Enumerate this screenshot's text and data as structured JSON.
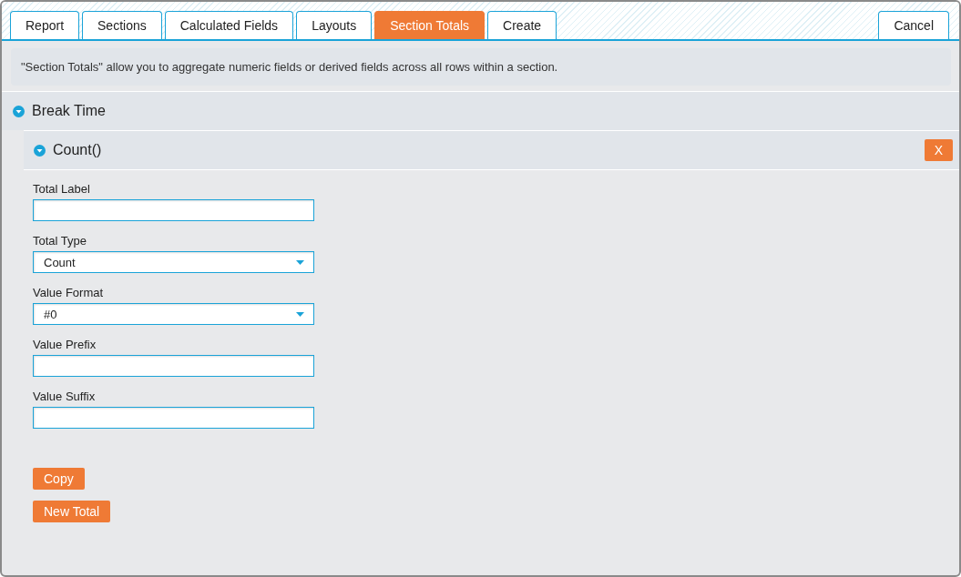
{
  "tabs": [
    {
      "label": "Report",
      "selected": false
    },
    {
      "label": "Sections",
      "selected": false
    },
    {
      "label": "Calculated Fields",
      "selected": false
    },
    {
      "label": "Layouts",
      "selected": false
    },
    {
      "label": "Section Totals",
      "selected": true
    },
    {
      "label": "Create",
      "selected": false
    }
  ],
  "cancel_button": "Cancel",
  "info": "\"Section Totals\" allow you to aggregate numeric fields or derived fields across all rows within a section.",
  "section": {
    "title": "Break Time",
    "expanded": true,
    "total": {
      "title": "Count()",
      "expanded": true,
      "remove_button": "X",
      "fields": [
        {
          "label": "Total Label",
          "kind": "text"
        },
        {
          "label": "Total Type",
          "kind": "select",
          "value": "Count"
        },
        {
          "label": "Value Format",
          "kind": "select",
          "value": "#0"
        },
        {
          "label": "Value Prefix",
          "kind": "text"
        },
        {
          "label": "Value Suffix",
          "kind": "text"
        }
      ]
    }
  },
  "buttons": [
    "Copy",
    "New Total"
  ]
}
